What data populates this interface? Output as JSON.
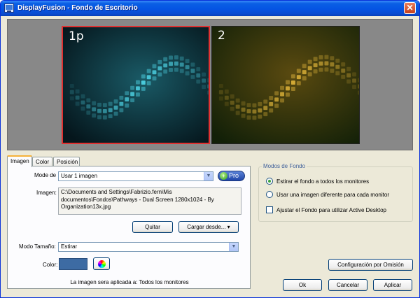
{
  "window": {
    "title": "DisplayFusion - Fondo de Escritorio",
    "close_glyph": "✕",
    "icon": "monitor-icon"
  },
  "preview": {
    "monitors": [
      {
        "label": "1p"
      },
      {
        "label": "2"
      }
    ]
  },
  "tabs": [
    {
      "label": "Imagen"
    },
    {
      "label": "Color"
    },
    {
      "label": "Posición"
    }
  ],
  "image_tab": {
    "mode_label": "Mode de",
    "mode_value": "Usar 1 imagen",
    "pro_label": "Pro",
    "image_label": "Imagen:",
    "image_path_lines": [
      "C:\\Documents and Settings\\Fabrizio.fern\\Mis",
      "documentos\\Fondos\\Pathways - Dual Screen 1280x1024 - By",
      "Organization13x.jpg"
    ],
    "remove_button": "Quitar",
    "load_button": "Cargar desde... ▾",
    "size_mode_label": "Modo Tamaño:",
    "size_mode_value": "Estirar",
    "color_label": "Color:",
    "applied_text": "La imagen sera aplicada a:  Todos los monitores"
  },
  "wallpaper_mode": {
    "group_title": "Modos de Fondo",
    "options": [
      {
        "label": "Estirar el fondo a todos los monitores",
        "selected": true
      },
      {
        "label": "Usar una imagen diferente para cada monitor",
        "selected": false
      }
    ],
    "active_desktop_label": "Ajustar el Fondo para utilizar Active Desktop",
    "active_desktop_checked": false
  },
  "buttons": {
    "defaults": "Configuración por Omisión",
    "ok": "Ok",
    "cancel": "Cancelar",
    "apply": "Aplicar"
  },
  "colors": {
    "monitor1_accent": "#4fd6e8",
    "monitor2_accent": "#e0b43a",
    "background_color": "#3d6ba3",
    "selected_monitor_border": "#e03030"
  }
}
